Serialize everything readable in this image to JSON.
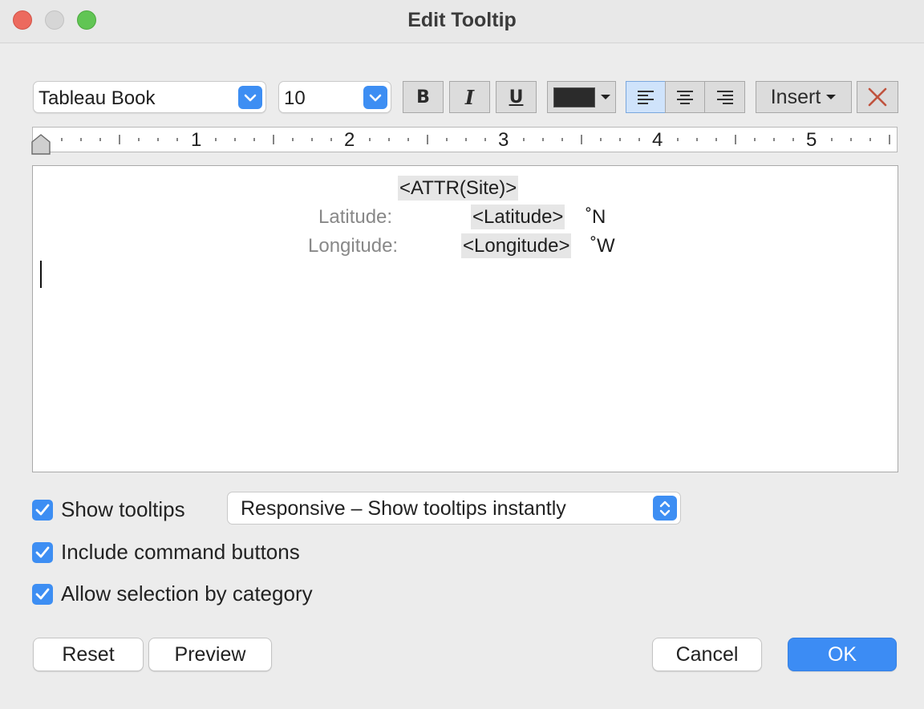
{
  "window": {
    "title": "Edit Tooltip"
  },
  "toolbar": {
    "font_family": "Tableau Book",
    "font_size": "10",
    "bold_label": "B",
    "italic_label": "I",
    "underline_label": "U",
    "text_color": "#2b2b2b",
    "insert_label": "Insert"
  },
  "ruler": {
    "marks": [
      "1",
      "2",
      "3",
      "4",
      "5"
    ]
  },
  "editor": {
    "title_field": "<ATTR(Site)>",
    "latitude_label": "Latitude:",
    "latitude_field": "<Latitude>",
    "latitude_unit": "˚N",
    "longitude_label": "Longitude:",
    "longitude_field": "<Longitude>",
    "longitude_unit": "˚W"
  },
  "options": {
    "show_tooltips": "Show tooltips",
    "tooltip_mode": "Responsive – Show tooltips instantly",
    "include_command_buttons": "Include command buttons",
    "allow_selection": "Allow selection by category"
  },
  "buttons": {
    "reset": "Reset",
    "preview": "Preview",
    "cancel": "Cancel",
    "ok": "OK"
  },
  "colors": {
    "accent": "#3d8ef3",
    "close_icon": "#c0533e"
  }
}
